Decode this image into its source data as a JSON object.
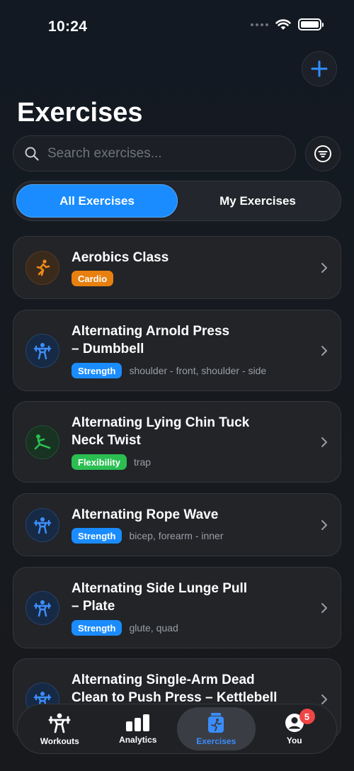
{
  "status_bar": {
    "time": "10:24"
  },
  "header": {
    "title": "Exercises"
  },
  "search": {
    "placeholder": "Search exercises..."
  },
  "segments": {
    "all": "All Exercises",
    "mine": "My Exercises",
    "active": "all"
  },
  "colors": {
    "accent": "#1a8cff",
    "cardio": "#e8800f",
    "strength": "#1a8cff",
    "flexibility": "#2bbf52"
  },
  "exercises": [
    {
      "line1": "Aerobics Class",
      "line2": "",
      "category": "Cardio",
      "muscles": "",
      "icon": "running-icon"
    },
    {
      "line1": "Alternating Arnold Press",
      "line2": "– Dumbbell",
      "category": "Strength",
      "muscles": "shoulder - front, shoulder - side",
      "icon": "weightlifter-icon"
    },
    {
      "line1": "Alternating Lying Chin Tuck",
      "line2": "Neck Twist",
      "category": "Flexibility",
      "muscles": "trap",
      "icon": "stretching-icon"
    },
    {
      "line1": "Alternating Rope Wave",
      "line2": "",
      "category": "Strength",
      "muscles": "bicep, forearm - inner",
      "icon": "weightlifter-icon"
    },
    {
      "line1": "Alternating Side Lunge Pull",
      "line2": "– Plate",
      "category": "Strength",
      "muscles": "glute, quad",
      "icon": "weightlifter-icon"
    },
    {
      "line1": "Alternating Single-Arm Dead",
      "line2": "Clean to Push Press – Kettlebell",
      "category": "",
      "muscles": "",
      "icon": "weightlifter-icon"
    }
  ],
  "tabs": [
    {
      "label": "Workouts",
      "icon": "weightlifter-icon"
    },
    {
      "label": "Analytics",
      "icon": "bar-chart-icon"
    },
    {
      "label": "Exercises",
      "icon": "exercise-jar-icon"
    },
    {
      "label": "You",
      "icon": "profile-icon",
      "badge": "5"
    }
  ]
}
